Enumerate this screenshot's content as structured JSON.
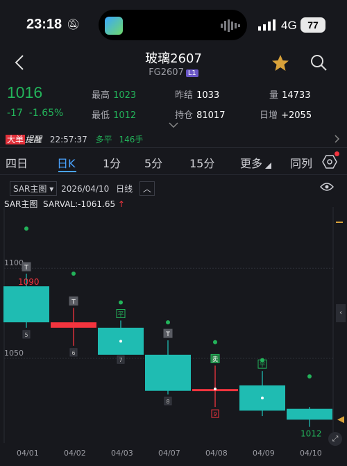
{
  "status_bar": {
    "time": "23:18",
    "network": "4G",
    "battery": "77"
  },
  "header": {
    "title": "玻璃2607",
    "code": "FG2607",
    "level": "L1"
  },
  "quote": {
    "last": "1016",
    "change": "-17",
    "change_pct": "-1.65%",
    "high_label": "最高",
    "high": "1023",
    "low_label": "最低",
    "low": "1012",
    "prev_settle_label": "昨结",
    "prev_settle": "1033",
    "oi_label": "持仓",
    "oi": "81017",
    "volume_label": "量",
    "volume": "14733",
    "daily_add_label": "日增",
    "daily_add": "+2055"
  },
  "ticker": {
    "tag1": "大单",
    "tag2": "提醒",
    "time": "22:57:37",
    "action": "多平",
    "qty": "146手"
  },
  "tabs": [
    "四日",
    "日K",
    "1分",
    "5分",
    "15分",
    "更多",
    "同列"
  ],
  "panel": {
    "indicator": "SAR主图",
    "date": "2026/04/10",
    "period": "日线",
    "sarval_label": "SAR主图",
    "sarval": "SARVAL:-1061.65"
  },
  "colors": {
    "up": "#f2343e",
    "down": "#1fbcb2",
    "green": "#23b35a",
    "accent": "#4aa3ff"
  },
  "chart_data": {
    "type": "candlestick",
    "x": [
      "04/01",
      "04/02",
      "04/03",
      "04/07",
      "04/08",
      "04/09",
      "04/10"
    ],
    "ohlc": [
      {
        "open": 1090,
        "high": 1097,
        "low": 1067,
        "close": 1070,
        "color": "cyan"
      },
      {
        "open": 1070,
        "high": 1078,
        "low": 1057,
        "close": 1067,
        "color": "red"
      },
      {
        "open": 1067,
        "high": 1071,
        "low": 1053,
        "close": 1052,
        "color": "cyan"
      },
      {
        "open": 1052,
        "high": 1060,
        "low": 1030,
        "close": 1032,
        "color": "cyan"
      },
      {
        "open": 1033,
        "high": 1046,
        "low": 1023,
        "close": 1033,
        "color": "red"
      },
      {
        "open": 1035,
        "high": 1043,
        "low": 1018,
        "close": 1021,
        "color": "cyan"
      },
      {
        "open": 1022,
        "high": 1023,
        "low": 1012,
        "close": 1016,
        "color": "cyan"
      }
    ],
    "sar": [
      1122,
      1097,
      1081,
      1070,
      1059,
      1049,
      1040
    ],
    "y_ticks": [
      1100,
      1050
    ],
    "ylim": [
      1003,
      1134
    ],
    "labels": {
      "max": "1090",
      "min": "1012"
    },
    "markers": [
      {
        "i": 0,
        "tag": "T",
        "pos": "top",
        "num": "5"
      },
      {
        "i": 1,
        "tag": "T",
        "pos": "top",
        "num": "6"
      },
      {
        "i": 2,
        "tag": "平",
        "pos": "top",
        "num": "7"
      },
      {
        "i": 3,
        "tag": "T",
        "pos": "top",
        "num": "8"
      },
      {
        "i": 4,
        "tag": "卖",
        "pos": "top",
        "num": "9"
      },
      {
        "i": 5,
        "tag": "平",
        "pos": "top",
        "num": ""
      }
    ]
  }
}
